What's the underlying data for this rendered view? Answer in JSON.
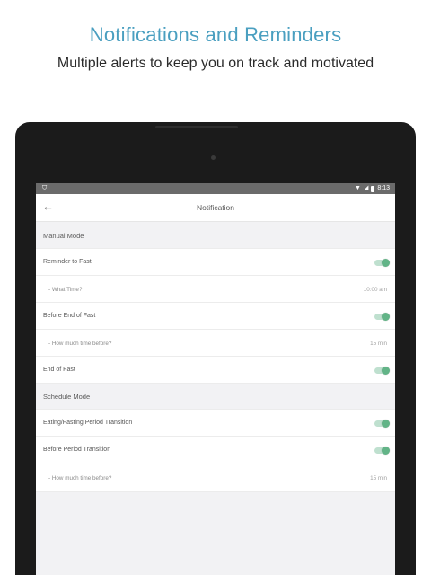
{
  "promo": {
    "headline": "Notifications and Reminders",
    "subheadline": "Multiple alerts to keep you on track and motivated"
  },
  "status_bar": {
    "time": "8:13",
    "icons": [
      "shield-icon",
      "wifi-icon",
      "signal-icon",
      "battery-icon"
    ]
  },
  "app_bar": {
    "back_icon": "arrow-left-icon",
    "title": "Notification"
  },
  "settings": {
    "manual_mode": {
      "header": "Manual Mode"
    },
    "reminder_to_fast": {
      "label": "Reminder to Fast",
      "enabled": true
    },
    "what_time": {
      "label": "- What Time?",
      "value": "10:00 am"
    },
    "before_end_of_fast": {
      "label": "Before End of Fast",
      "enabled": true
    },
    "how_much_before_1": {
      "label": "- How much time before?",
      "value": "15 min"
    },
    "end_of_fast": {
      "label": "End of Fast",
      "enabled": true
    },
    "schedule_mode": {
      "header": "Schedule Mode"
    },
    "eating_fasting_transition": {
      "label": "Eating/Fasting Period Transition",
      "enabled": true
    },
    "before_period_transition": {
      "label": "Before Period Transition",
      "enabled": true
    },
    "how_much_before_2": {
      "label": "- How much time before?",
      "value": "15 min"
    }
  },
  "colors": {
    "headline": "#4a9fc0",
    "toggle_on_thumb": "#62b487",
    "toggle_on_track": "#bfe0cf",
    "device": "#1b1b1b"
  }
}
